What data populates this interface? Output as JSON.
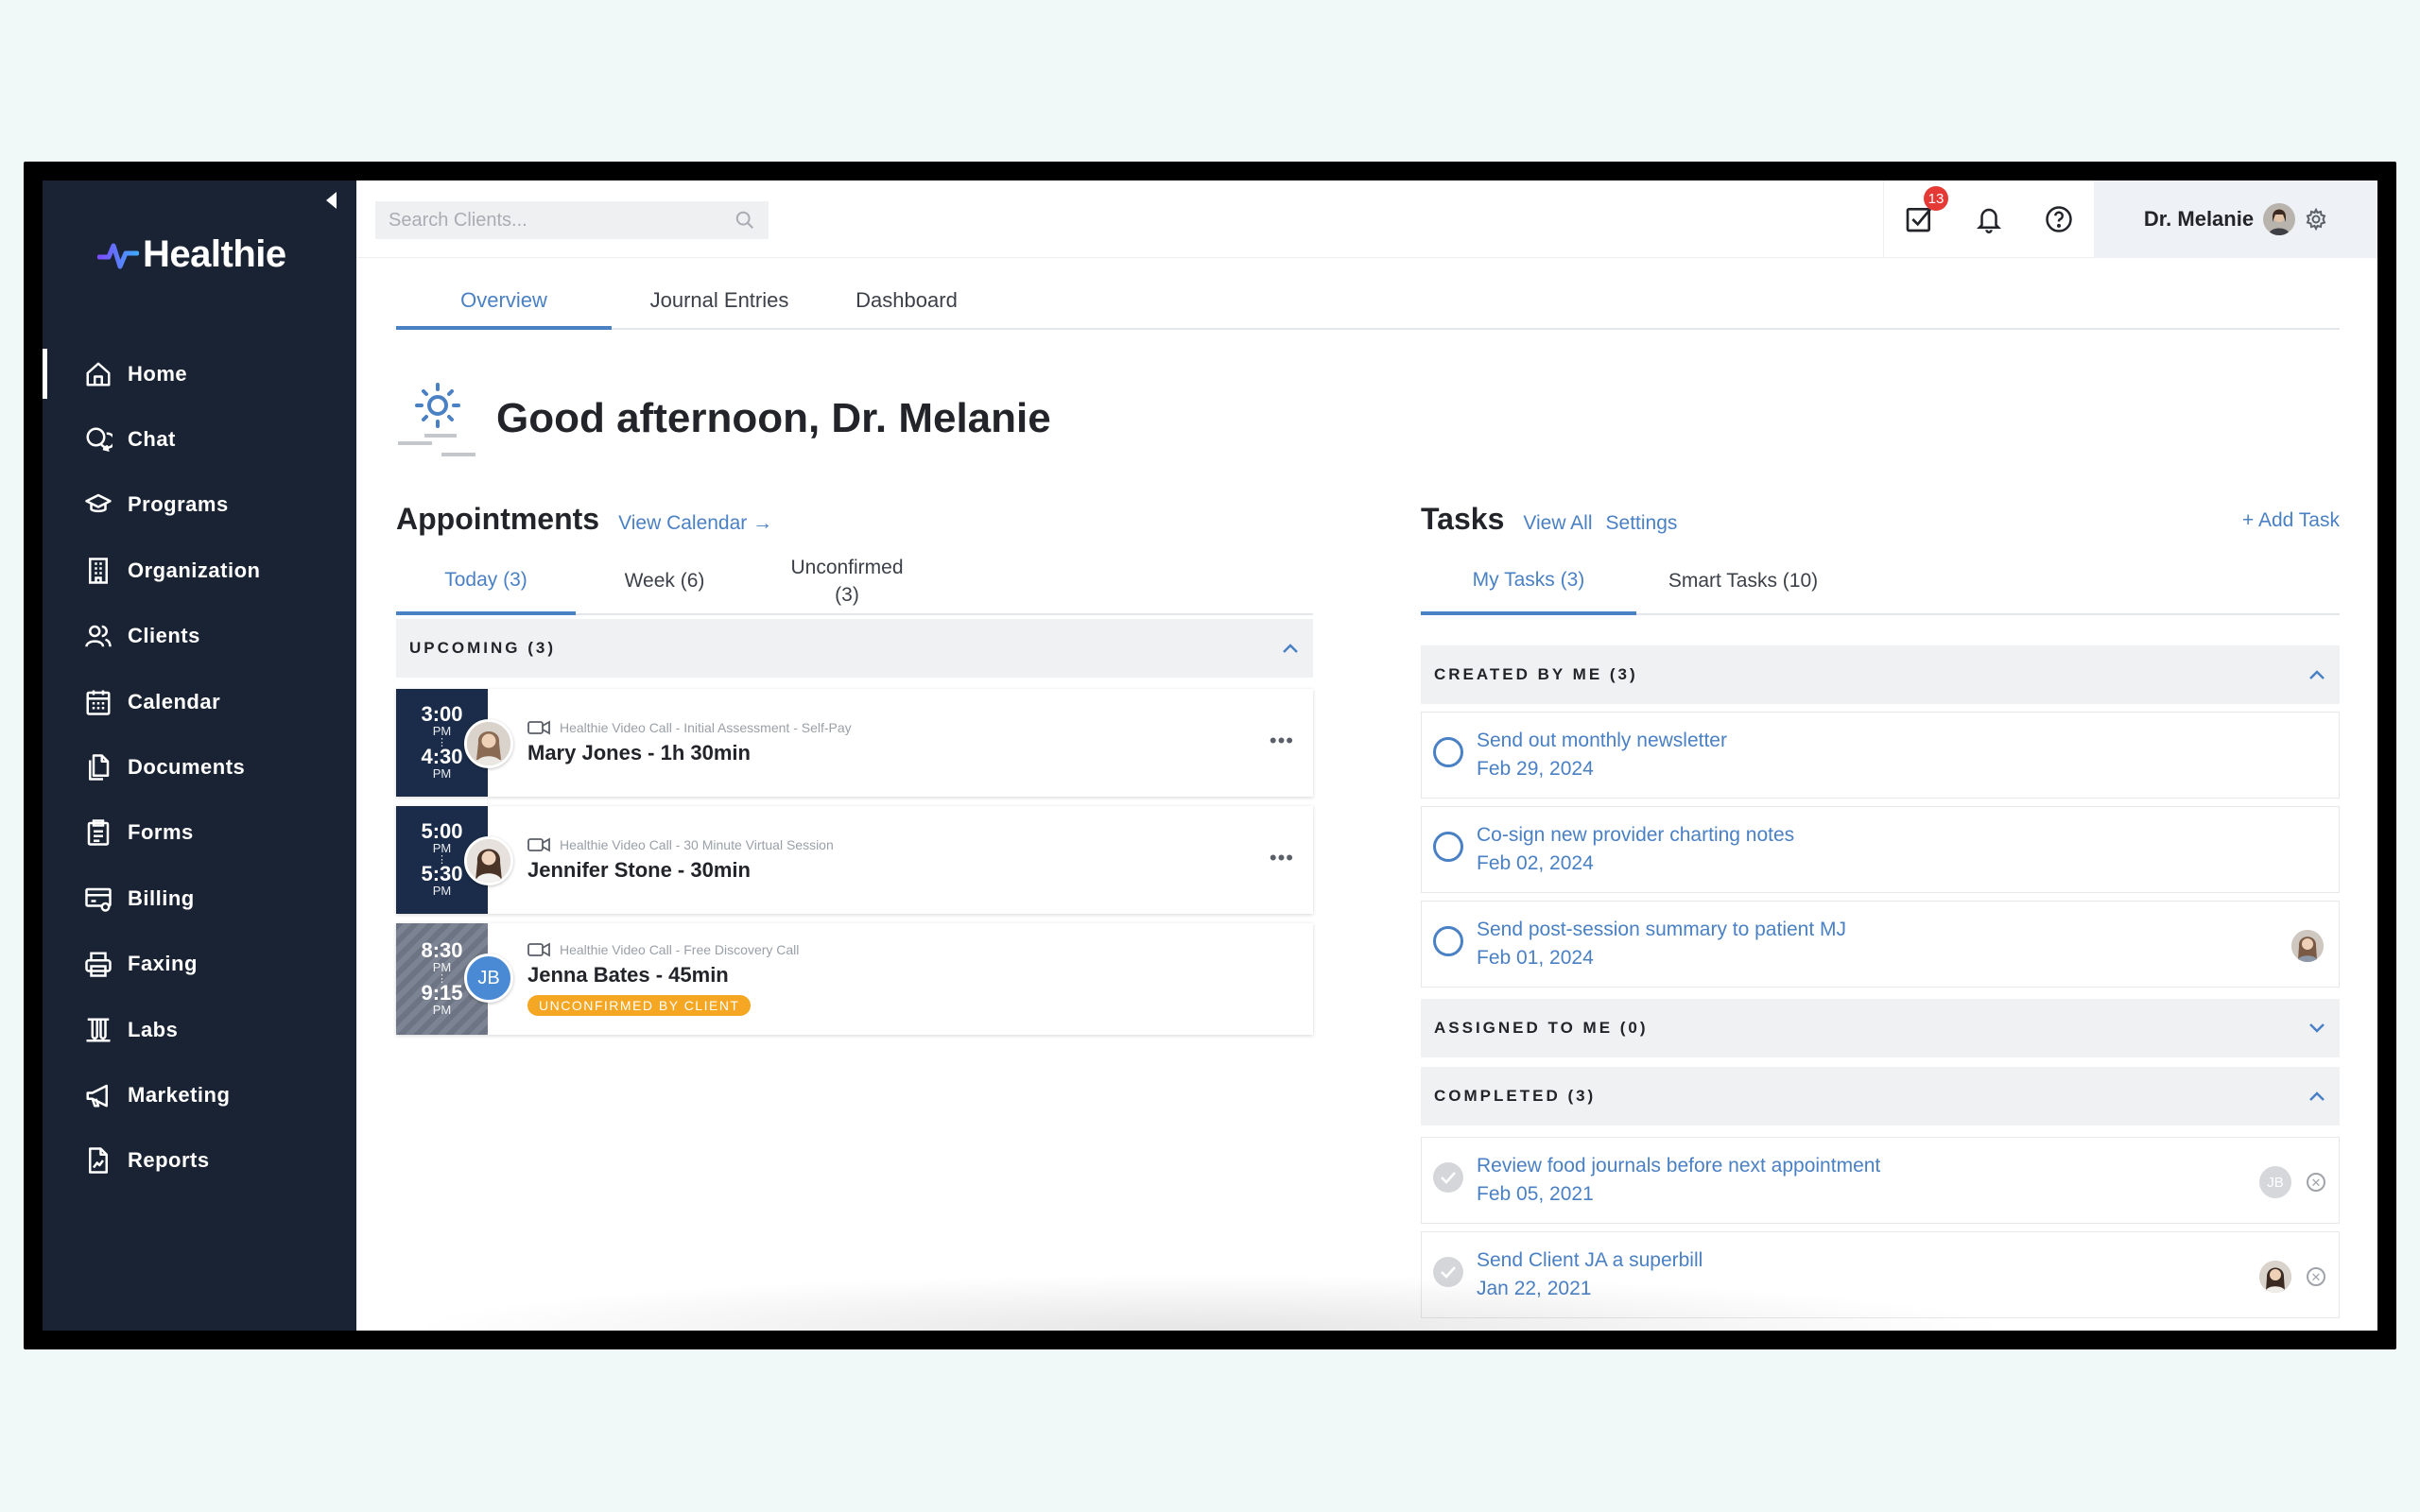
{
  "brand": {
    "name": "Healthie"
  },
  "sidebar": {
    "items": [
      {
        "label": "Home",
        "icon": "home-icon"
      },
      {
        "label": "Chat",
        "icon": "chat-icon"
      },
      {
        "label": "Programs",
        "icon": "graduation-cap-icon"
      },
      {
        "label": "Organization",
        "icon": "building-icon"
      },
      {
        "label": "Clients",
        "icon": "users-icon"
      },
      {
        "label": "Calendar",
        "icon": "calendar-icon"
      },
      {
        "label": "Documents",
        "icon": "documents-icon"
      },
      {
        "label": "Forms",
        "icon": "clipboard-icon"
      },
      {
        "label": "Billing",
        "icon": "billing-icon"
      },
      {
        "label": "Faxing",
        "icon": "printer-icon"
      },
      {
        "label": "Labs",
        "icon": "test-tubes-icon"
      },
      {
        "label": "Marketing",
        "icon": "megaphone-icon"
      },
      {
        "label": "Reports",
        "icon": "reports-icon"
      }
    ]
  },
  "topbar": {
    "search_placeholder": "Search Clients...",
    "tasks_badge": "13",
    "user_name": "Dr. Melanie"
  },
  "tabs": [
    "Overview",
    "Journal Entries",
    "Dashboard"
  ],
  "greeting": "Good afternoon, Dr. Melanie",
  "appointments": {
    "title": "Appointments",
    "view_calendar": "View Calendar →",
    "tabs": [
      "Today (3)",
      "Week (6)",
      "Unconfirmed",
      "(3)"
    ],
    "group_label": "UPCOMING (3)",
    "items": [
      {
        "start": "3:00",
        "start_ampm": "PM",
        "end": "4:30",
        "end_ampm": "PM",
        "type": "Healthie Video Call - Initial Assessment - Self-Pay",
        "name": "Mary Jones - 1h 30min"
      },
      {
        "start": "5:00",
        "start_ampm": "PM",
        "end": "5:30",
        "end_ampm": "PM",
        "type": "Healthie Video Call - 30 Minute Virtual Session",
        "name": "Jennifer Stone - 30min"
      },
      {
        "start": "8:30",
        "start_ampm": "PM",
        "end": "9:15",
        "end_ampm": "PM",
        "type": "Healthie Video Call - Free Discovery Call",
        "name": "Jenna Bates - 45min",
        "initials": "JB",
        "status": "UNCONFIRMED BY CLIENT"
      }
    ]
  },
  "tasks": {
    "title": "Tasks",
    "view_all": "View All",
    "settings": "Settings",
    "add_task": "+ Add Task",
    "tabs": [
      "My Tasks (3)",
      "Smart Tasks (10)"
    ],
    "groups": {
      "created": "CREATED BY ME (3)",
      "assigned": "ASSIGNED TO ME (0)",
      "completed": "COMPLETED (3)"
    },
    "created_items": [
      {
        "title": "Send out monthly newsletter",
        "date": "Feb 29, 2024"
      },
      {
        "title": "Co-sign new provider charting notes",
        "date": "Feb 02, 2024"
      },
      {
        "title": "Send post-session summary to patient MJ",
        "date": "Feb 01, 2024"
      }
    ],
    "completed_items": [
      {
        "title": "Review food journals before next appointment",
        "date": "Feb 05, 2021",
        "initials": "JB"
      },
      {
        "title": "Send Client JA a superbill",
        "date": "Jan 22, 2021"
      }
    ]
  },
  "colors": {
    "sidebar": "#1a2333",
    "accent": "#4a80c4",
    "badge": "#e53935",
    "pill": "#f5a623"
  }
}
